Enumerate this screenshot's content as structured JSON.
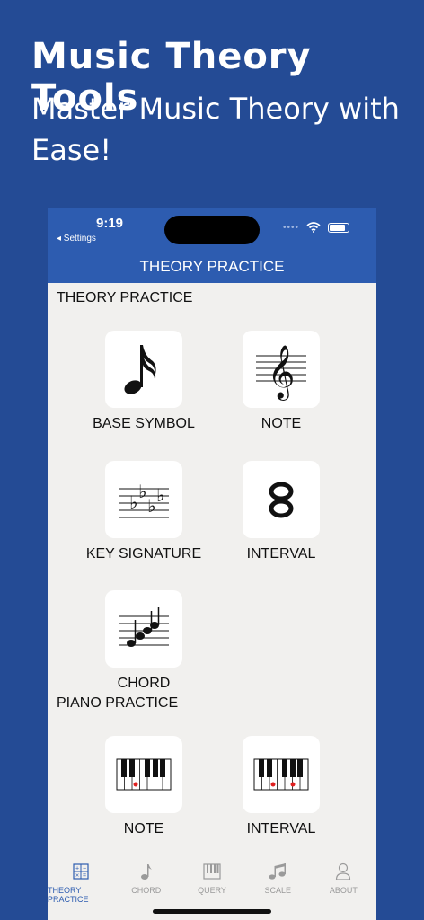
{
  "hero": {
    "title": "Music Theory Tools",
    "subtitle": "Master Music Theory with Ease!"
  },
  "status_bar": {
    "time": "9:19",
    "back": "◂ Settings"
  },
  "nav": {
    "title": "THEORY PRACTICE"
  },
  "sections": {
    "theory": "THEORY PRACTICE",
    "piano": "PIANO PRACTICE"
  },
  "tiles": {
    "base_symbol": "BASE SYMBOL",
    "note": "NOTE",
    "key_signature": "KEY SIGNATURE",
    "interval": "INTERVAL",
    "chord": "CHORD",
    "piano_note": "NOTE",
    "piano_interval": "INTERVAL"
  },
  "tab_bar": {
    "items": [
      {
        "label": "THEORY PRACTICE",
        "icon": "calculator-icon",
        "active": true
      },
      {
        "label": "CHORD",
        "icon": "music-note-icon",
        "active": false
      },
      {
        "label": "QUERY",
        "icon": "piano-icon",
        "active": false
      },
      {
        "label": "SCALE",
        "icon": "music-notes-icon",
        "active": false
      },
      {
        "label": "ABOUT",
        "icon": "person-icon",
        "active": false
      }
    ]
  },
  "colors": {
    "background": "#244b95",
    "header": "#2d5cb0",
    "accent": "#2d5cb0",
    "inactive_tab": "#9a9a9a",
    "piano_marker": "#e02020"
  }
}
